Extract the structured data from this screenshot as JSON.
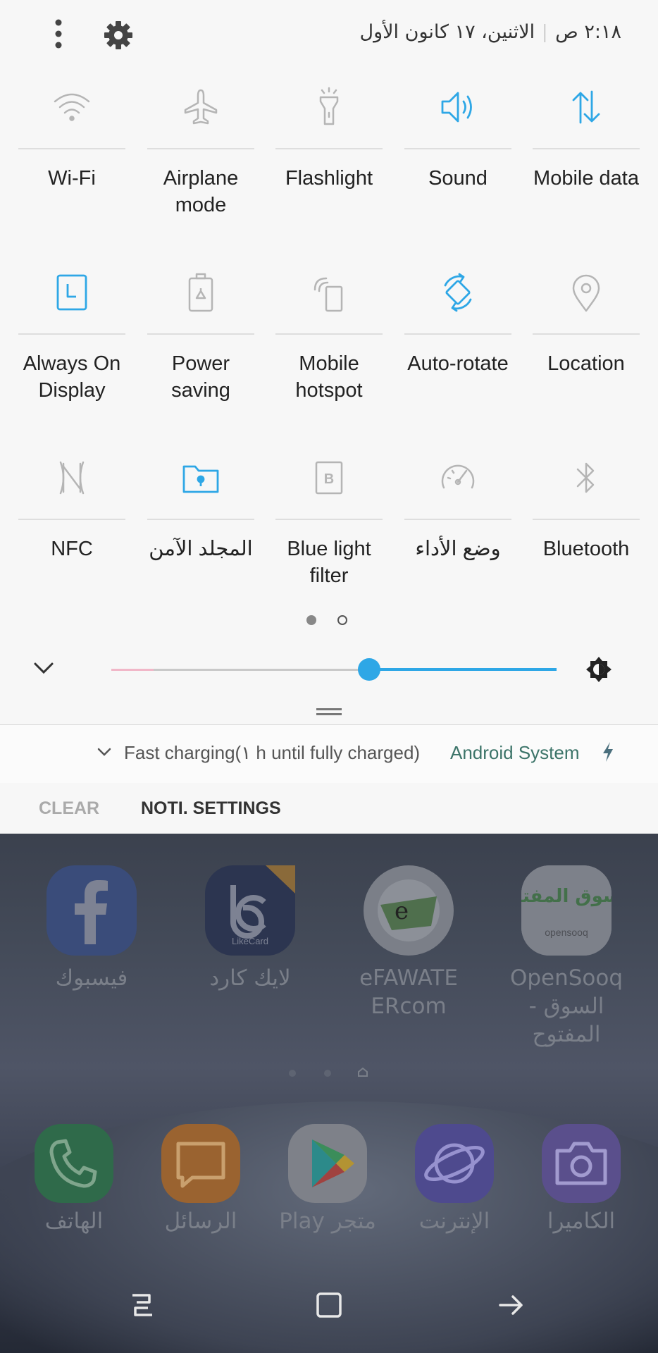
{
  "status_bar": {
    "time": "٢:١٨ ص",
    "date": "الاثنين، ١٧ كانون الأول"
  },
  "quick_settings": {
    "tiles": [
      {
        "label": "Wi-Fi",
        "icon": "wifi-icon",
        "active": false
      },
      {
        "label": "Airplane mode",
        "icon": "airplane-icon",
        "active": false
      },
      {
        "label": "Flashlight",
        "icon": "flashlight-icon",
        "active": false
      },
      {
        "label": "Sound",
        "icon": "sound-icon",
        "active": true
      },
      {
        "label": "Mobile data",
        "icon": "mobile-data-icon",
        "active": true
      },
      {
        "label": "Always On Display",
        "icon": "always-on-display-icon",
        "active": true
      },
      {
        "label": "Power saving",
        "icon": "power-saving-icon",
        "active": false
      },
      {
        "label": "Mobile hotspot",
        "icon": "hotspot-icon",
        "active": false
      },
      {
        "label": "Auto-rotate",
        "icon": "auto-rotate-icon",
        "active": true
      },
      {
        "label": "Location",
        "icon": "location-icon",
        "active": false
      },
      {
        "label": "NFC",
        "icon": "nfc-icon",
        "active": false
      },
      {
        "label": "المجلد الآمن",
        "icon": "secure-folder-icon",
        "active": true
      },
      {
        "label": "Blue light filter",
        "icon": "blue-light-icon",
        "active": false
      },
      {
        "label": "وضع الأداء",
        "icon": "performance-icon",
        "active": false
      },
      {
        "label": "Bluetooth",
        "icon": "bluetooth-icon",
        "active": false
      }
    ],
    "page_count": 2,
    "current_page": 1,
    "brightness_level": 0.58,
    "colors": {
      "active": "#2ea7e6",
      "inactive": "#b5b5b5"
    }
  },
  "notification": {
    "text": "Fast charging(١ h until fully charged)",
    "app": "Android System"
  },
  "actions": {
    "clear": "CLEAR",
    "settings": "NOTI. SETTINGS"
  },
  "home": {
    "apps": [
      {
        "label": "فيسبوك",
        "icon": "facebook-icon"
      },
      {
        "label": "لايك كارد",
        "icon": "likecard-icon"
      },
      {
        "label": "eFAWATEERcom",
        "icon": "efawateer-icon"
      },
      {
        "label": "OpenSooq - السوق المفتوح",
        "icon": "opensooq-icon"
      }
    ],
    "icon_texts": {
      "likecard": "LikeCard",
      "opensooq_ar": "السوق المفتوح",
      "opensooq_en": "opensooq"
    },
    "dock": [
      {
        "label": "الهاتف",
        "icon": "phone-icon"
      },
      {
        "label": "الرسائل",
        "icon": "messages-icon"
      },
      {
        "label": "Play متجر",
        "icon": "play-store-icon"
      },
      {
        "label": "الإنترنت",
        "icon": "internet-icon"
      },
      {
        "label": "الكاميرا",
        "icon": "camera-icon"
      }
    ]
  }
}
